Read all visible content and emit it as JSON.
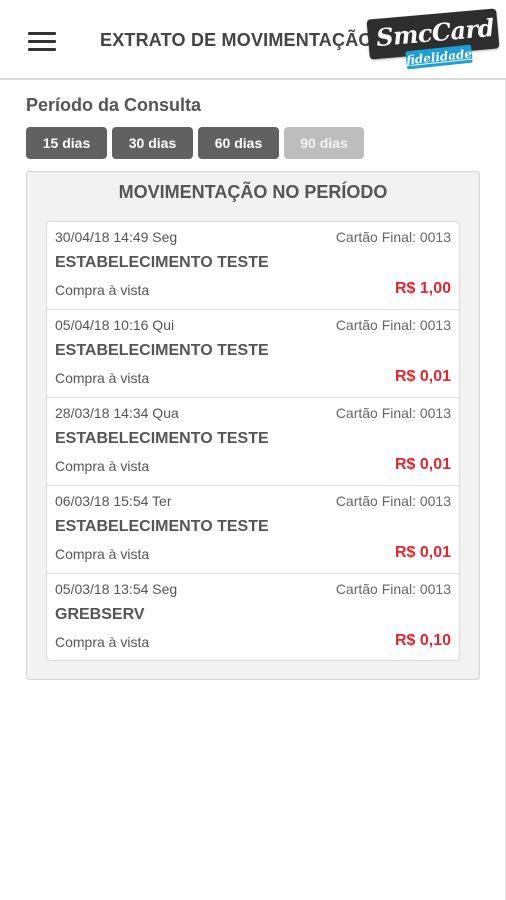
{
  "header": {
    "title": "EXTRATO DE MOVIMENTAÇÃO",
    "menu_icon": "hamburger-menu-icon",
    "logo": {
      "main_text": "SmcCard",
      "sub_text": "fidelidade",
      "colors": {
        "main_bg": "#2e2e2e",
        "sub_bg": "#1b9fd6"
      }
    }
  },
  "period": {
    "label": "Período da Consulta",
    "buttons": [
      {
        "label": "15 dias",
        "enabled": true
      },
      {
        "label": "30 dias",
        "enabled": true
      },
      {
        "label": "60 dias",
        "enabled": true
      },
      {
        "label": "90 dias",
        "enabled": false
      }
    ]
  },
  "movement": {
    "title": "MOVIMENTAÇÃO NO PERÍODO",
    "transactions": [
      {
        "date": "30/04/18 14:49 Seg",
        "card": "Cartão Final: 0013",
        "merchant": "ESTABELECIMENTO TESTE",
        "type": "Compra à vista",
        "amount": "R$ 1,00"
      },
      {
        "date": "05/04/18 10:16 Qui",
        "card": "Cartão Final: 0013",
        "merchant": "ESTABELECIMENTO TESTE",
        "type": "Compra à vista",
        "amount": "R$ 0,01"
      },
      {
        "date": "28/03/18 14:34 Qua",
        "card": "Cartão Final: 0013",
        "merchant": "ESTABELECIMENTO TESTE",
        "type": "Compra à vista",
        "amount": "R$ 0,01"
      },
      {
        "date": "06/03/18 15:54 Ter",
        "card": "Cartão Final: 0013",
        "merchant": "ESTABELECIMENTO TESTE",
        "type": "Compra à vista",
        "amount": "R$ 0,01"
      },
      {
        "date": "05/03/18 13:54 Seg",
        "card": "Cartão Final: 0013",
        "merchant": "GREBSERV",
        "type": "Compra à vista",
        "amount": "R$ 0,10"
      }
    ]
  },
  "colors": {
    "amount": "#e4262f",
    "button_active": "#616161",
    "button_disabled": "#bdbdbd"
  }
}
